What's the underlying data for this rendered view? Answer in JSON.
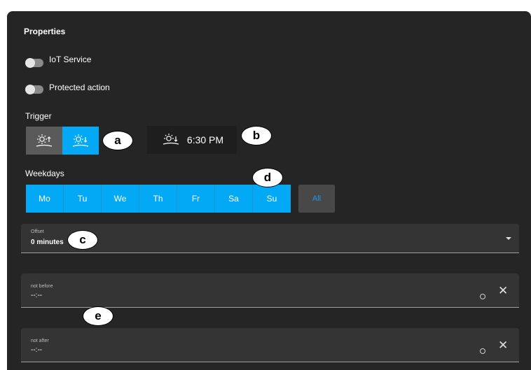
{
  "properties": {
    "title": "Properties",
    "iot_service_label": "IoT Service",
    "protected_action_label": "Protected action"
  },
  "trigger": {
    "title": "Trigger",
    "options": [
      "sunrise",
      "sunset"
    ],
    "selected": "sunset",
    "time": "6:30 PM"
  },
  "weekdays": {
    "title": "Weekdays",
    "days": [
      "Mo",
      "Tu",
      "We",
      "Th",
      "Fr",
      "Sa",
      "Su"
    ],
    "all_label": "All"
  },
  "offset": {
    "label": "Offset",
    "value": "0 minutes"
  },
  "not_before": {
    "label": "not before",
    "value": "--:--"
  },
  "not_after": {
    "label": "not after",
    "value": "--:--"
  },
  "callouts": {
    "a": "a",
    "b": "b",
    "c": "c",
    "d": "d",
    "e": "e"
  },
  "colors": {
    "panel_bg": "#252525",
    "accent": "#03a9f4",
    "field_bg": "#343434"
  },
  "icons": {
    "sunrise": "sunrise-icon",
    "sunset": "sunset-icon",
    "clock": "clock-icon",
    "close": "close-icon",
    "dropdown": "chevron-down-icon"
  }
}
